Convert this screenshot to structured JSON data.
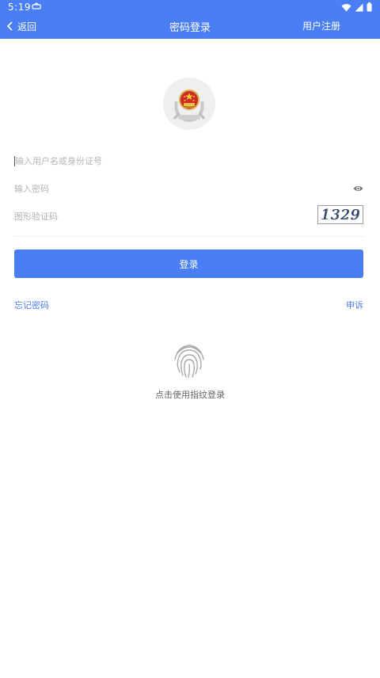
{
  "status_bar": {
    "time": "5:19"
  },
  "header": {
    "back_label": "返回",
    "title": "密码登录",
    "register_label": "用户注册"
  },
  "form": {
    "username_placeholder": "输入用户名或身份证号",
    "password_placeholder": "输入密码",
    "captcha_placeholder": "图形验证码",
    "captcha_code": "1329",
    "login_label": "登录"
  },
  "links": {
    "forgot_password": "忘记密码",
    "appeal": "申诉"
  },
  "fingerprint": {
    "label": "点击使用指纹登录"
  },
  "colors": {
    "primary": "#4a7ef5",
    "placeholder": "#b5b5b5",
    "hint_text": "#666666"
  }
}
